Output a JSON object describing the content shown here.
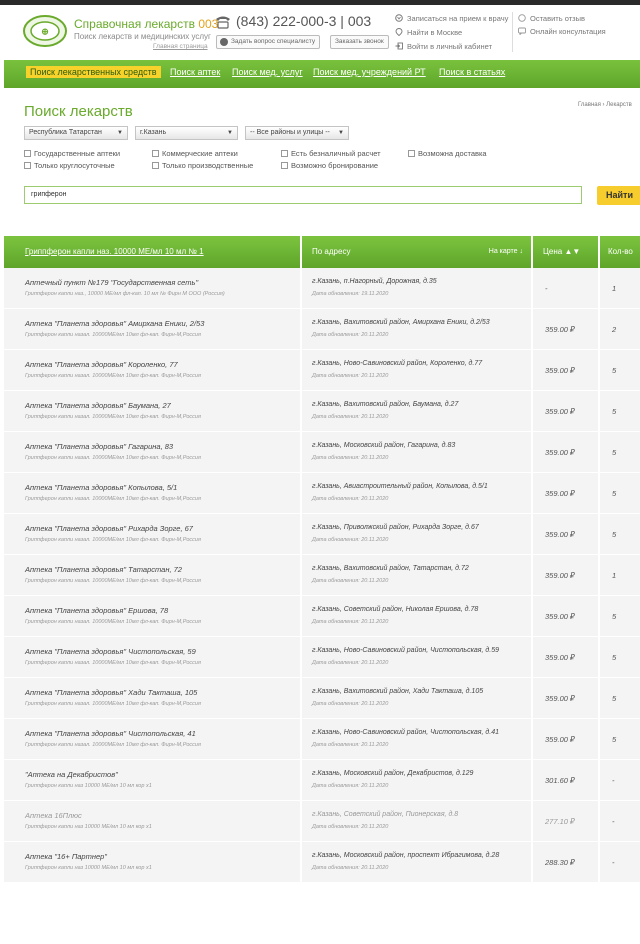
{
  "header": {
    "brand_title": "Справочная лекарств",
    "brand_num": "003",
    "brand_sub": "Поиск лекарств и медицинских услуг",
    "brand_home": "Главная страница",
    "phone": "(843) 222-000-3 | 003",
    "ask_label": "Задать вопрос специалисту",
    "call_label": "Заказать звонок",
    "link_doctor": "Записаться на прием к врачу",
    "link_moscow": "Найти в Москве",
    "link_cabinet": "Войти в личный кабинет",
    "link_review": "Оставить отзыв",
    "link_consult": "Онлайн консультация"
  },
  "nav": [
    "Поиск лекарственных средств",
    "Поиск аптек",
    "Поиск мед. услуг",
    "Поиск мед. учреждений РТ",
    "Поиск в статьях"
  ],
  "search": {
    "title": "Поиск лекарств",
    "breadcrumb": "Главная   ›   Лекарств",
    "region": "Республика Татарстан",
    "city": "г.Казань",
    "district": "-- Все районы и улицы --",
    "checks": [
      "Государственные аптеки",
      "Коммерческие аптеки",
      "Есть безналичный расчет",
      "Возможна доставка",
      "Только круглосуточные",
      "Только производственные",
      "Возможно бронирование"
    ],
    "query": "грипферон",
    "button": "Найти"
  },
  "table": {
    "product_header": "Гриппферон капли наз. 10000 МЕ/мл 10 мл № 1",
    "address_header": "По адресу",
    "map_link": "На карте ↓",
    "price_header": "Цена ▲▼",
    "qty_header": "Кол-во",
    "rows": [
      {
        "name": "Аптечный пункт №179 \"Государственная сеть\"",
        "desc": "Гриппферон капли наз., 10000 МЕ/мл фл-кап. 10 мл № Фирн М ООО (Россия)",
        "addr": "г.Казань, п.Нагорный, Дорожная, д.35",
        "upd": "Дата обновления: 19.11.2020",
        "price": "-",
        "qty": "1",
        "dim": false
      },
      {
        "name": "Аптека \"Планета здоровья\" Амирхана Еники, 2/53",
        "desc": "Гриппферон капли назал. 10000МЕ/мл 10мл фл-кап. Фирн-М,Россия",
        "addr": "г.Казань, Вахитовский район, Амирхана Еники, д.2/53",
        "upd": "Дата обновления: 20.11.2020",
        "price": "359.00 ₽",
        "qty": "2",
        "dim": false
      },
      {
        "name": "Аптека \"Планета здоровья\" Короленко, 77",
        "desc": "Гриппферон капли назал. 10000МЕ/мл 10мл фл-кап. Фирн-М,Россия",
        "addr": "г.Казань, Ново-Савиновский район, Короленко, д.77",
        "upd": "Дата обновления: 20.11.2020",
        "price": "359.00 ₽",
        "qty": "5",
        "dim": false
      },
      {
        "name": "Аптека \"Планета здоровья\" Баумана, 27",
        "desc": "Гриппферон капли назал. 10000МЕ/мл 10мл фл-кап. Фирн-М,Россия",
        "addr": "г.Казань, Вахитовский район, Баумана, д.27",
        "upd": "Дата обновления: 20.11.2020",
        "price": "359.00 ₽",
        "qty": "5",
        "dim": false
      },
      {
        "name": "Аптека \"Планета здоровья\" Гагарина, 83",
        "desc": "Гриппферон капли назал. 10000МЕ/мл 10мл фл-кап. Фирн-М,Россия",
        "addr": "г.Казань, Московский район, Гагарина, д.83",
        "upd": "Дата обновления: 20.11.2020",
        "price": "359.00 ₽",
        "qty": "5",
        "dim": false
      },
      {
        "name": "Аптека \"Планета здоровья\" Копылова, 5/1",
        "desc": "Гриппферон капли назал. 10000МЕ/мл 10мл фл-кап. Фирн-М,Россия",
        "addr": "г.Казань, Авиастроительный район, Копылова, д.5/1",
        "upd": "Дата обновления: 20.11.2020",
        "price": "359.00 ₽",
        "qty": "5",
        "dim": false
      },
      {
        "name": "Аптека \"Планета здоровья\" Рихарда Зорге, 67",
        "desc": "Гриппферон капли назал. 10000МЕ/мл 10мл фл-кап. Фирн-М,Россия",
        "addr": "г.Казань, Приволжский район, Рихарда Зорге, д.67",
        "upd": "Дата обновления: 20.11.2020",
        "price": "359.00 ₽",
        "qty": "5",
        "dim": false
      },
      {
        "name": "Аптека \"Планета здоровья\" Татарстан, 72",
        "desc": "Гриппферон капли назал. 10000МЕ/мл 10мл фл-кап. Фирн-М,Россия",
        "addr": "г.Казань, Вахитовский район, Татарстан, д.72",
        "upd": "Дата обновления: 20.11.2020",
        "price": "359.00 ₽",
        "qty": "1",
        "dim": false
      },
      {
        "name": "Аптека \"Планета здоровья\" Ершова, 78",
        "desc": "Гриппферон капли назал. 10000МЕ/мл 10мл фл-кап. Фирн-М,Россия",
        "addr": "г.Казань, Советский район, Николая Ершова, д.78",
        "upd": "Дата обновления: 20.11.2020",
        "price": "359.00 ₽",
        "qty": "5",
        "dim": false
      },
      {
        "name": "Аптека \"Планета здоровья\" Чистопольская, 59",
        "desc": "Гриппферон капли назал. 10000МЕ/мл 10мл фл-кап. Фирн-М,Россия",
        "addr": "г.Казань, Ново-Савиновский район, Чистопольская, д.59",
        "upd": "Дата обновления: 20.11.2020",
        "price": "359.00 ₽",
        "qty": "5",
        "dim": false
      },
      {
        "name": "Аптека \"Планета здоровья\" Хади Такташа, 105",
        "desc": "Гриппферон капли назал. 10000МЕ/мл 10мл фл-кап. Фирн-М,Россия",
        "addr": "г.Казань, Вахитовский район, Хади Такташа, д.105",
        "upd": "Дата обновления: 20.11.2020",
        "price": "359.00 ₽",
        "qty": "5",
        "dim": false
      },
      {
        "name": "Аптека \"Планета здоровья\" Чистопольская, 41",
        "desc": "Гриппферон капли назал. 10000МЕ/мл 10мл фл-кап. Фирн-М,Россия",
        "addr": "г.Казань, Ново-Савиновский район, Чистопольская, д.41",
        "upd": "Дата обновления: 20.11.2020",
        "price": "359.00 ₽",
        "qty": "5",
        "dim": false
      },
      {
        "name": "\"Аптека на Декабристов\"",
        "desc": "Гриппферон капли наз 10000 МЕ/мл 10 мл кор х1",
        "addr": "г.Казань, Московский район, Декабристов, д.129",
        "upd": "Дата обновления: 20.11.2020",
        "price": "301.60 ₽",
        "qty": "-",
        "dim": false
      },
      {
        "name": "Аптека 16Плюс",
        "desc": "Гриппферон капли наз 10000 МЕ/мл 10 мл кор х1",
        "addr": "г.Казань, Советский район, Пионерская, д.8",
        "upd": "Дата обновления: 20.11.2020",
        "price": "277.10 ₽",
        "qty": "-",
        "dim": true
      },
      {
        "name": "Аптека \"16+ Партнер\"",
        "desc": "Гриппферон капли наз 10000 МЕ/мл 10 мл кор х1",
        "addr": "г.Казань, Московский район, проспект Ибрагимова, д.28",
        "upd": "Дата обновления: 20.11.2020",
        "price": "288.30 ₽",
        "qty": "-",
        "dim": false
      }
    ]
  },
  "colors": {
    "accent_green": "#6aaa2c",
    "nav_green": "#5ea52a",
    "highlight_yellow": "#f6d22a",
    "row_bg": "#f4f4f4"
  }
}
